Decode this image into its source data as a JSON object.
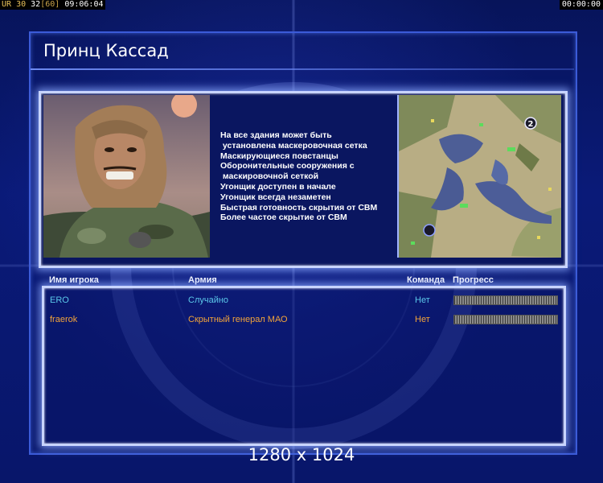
{
  "hud": {
    "left_prefix": "UR",
    "left_num1": "30",
    "left_num2": "32",
    "left_num3": "[60]",
    "left_time": "09:06:04",
    "right_time": "00:00:00"
  },
  "general": {
    "title": "Принц Кассад",
    "features": [
      "На все здания может быть",
      " установлена маскеровочная сетка",
      "Маскирующиеся повстанцы",
      "Оборонительные сооружения с",
      " маскировочной сеткой",
      "Угонщик доступен в начале",
      "Угонщик всегда незаметен",
      "Быстрая готовность скрытия от СВМ",
      "Более частое скрытие от СВМ"
    ]
  },
  "minimap": {
    "markers": [
      "2"
    ]
  },
  "table": {
    "headers": {
      "player": "Имя игрока",
      "army": "Армия",
      "team": "Команда",
      "progress": "Прогресс"
    },
    "rows": [
      {
        "name": "ERO",
        "army": "Случайно",
        "team": "Нет",
        "color": "#5bc8ea",
        "army_color": "#5bc8ea",
        "progress": 1.0
      },
      {
        "name": "fraerok",
        "army": "Скрытный генерал МАО",
        "team": "Нет",
        "color": "#f2a43a",
        "army_color": "#f2a43a",
        "progress": 1.0
      }
    ]
  },
  "footer": {
    "resolution": "1280 x 1024"
  }
}
